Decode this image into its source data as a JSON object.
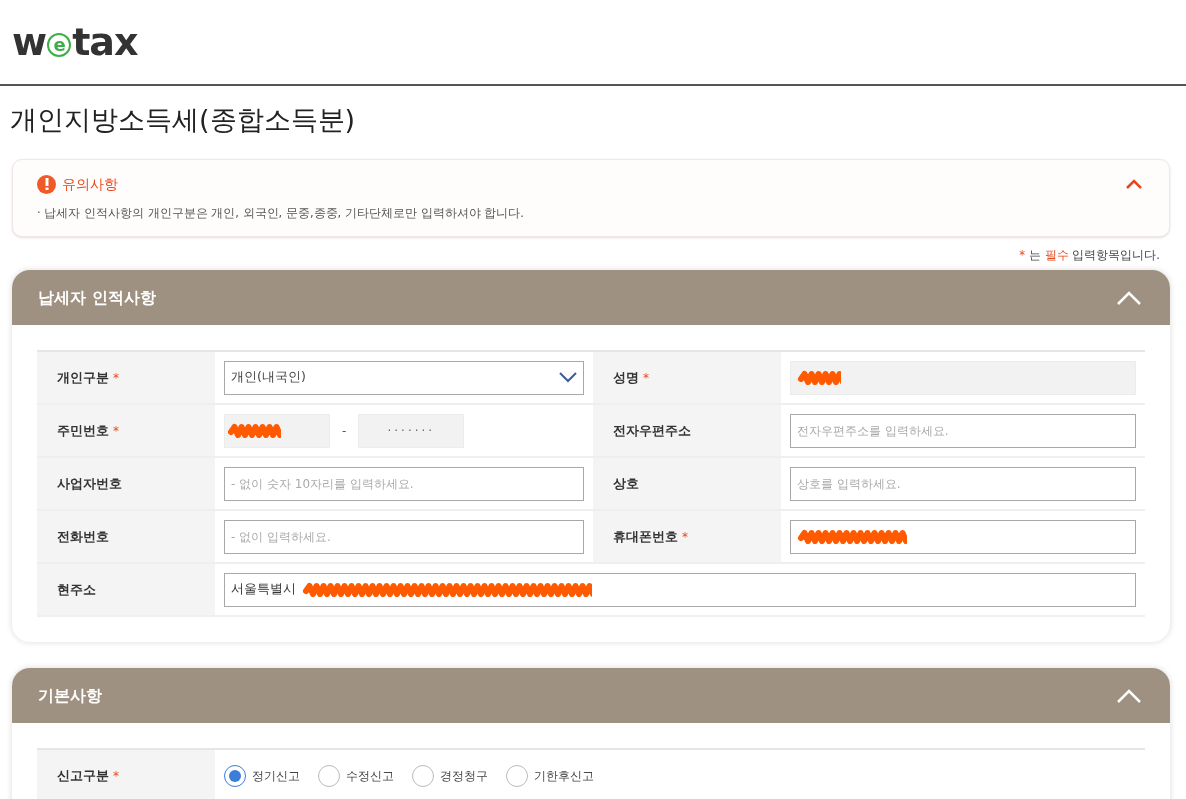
{
  "logo": {
    "before": "w",
    "mark": "e",
    "after": "tax"
  },
  "page_title": "개인지방소득세(종합소득분)",
  "notice": {
    "title": "유의사항",
    "expanded": true,
    "items": [
      "· 납세자 인적사항의 개인구분은 개인, 외국인, 문중,종중, 기타단체로만 입력하셔야 합니다."
    ]
  },
  "required_note": {
    "mark": "*",
    "text": "는 **필수** 입력항목입니다."
  },
  "sections": [
    {
      "title": "납세자 인적사항",
      "expanded": true,
      "rows": [
        [
          {
            "label": "개인구분",
            "required": true,
            "field": {
              "kind": "select",
              "value": "개인(내국인)"
            }
          },
          {
            "label": "성명",
            "required": true,
            "field": {
              "kind": "readonly",
              "redacted": true
            }
          }
        ],
        [
          {
            "label": "주민번호",
            "required": true,
            "field": {
              "kind": "split",
              "first": {
                "redacted": true
              },
              "separator": "-",
              "second": {
                "value": "·······"
              }
            }
          },
          {
            "label": "전자우편주소",
            "required": false,
            "field": {
              "kind": "text",
              "placeholder": "전자우편주소를 입력하세요."
            }
          }
        ],
        [
          {
            "label": "사업자번호",
            "required": false,
            "field": {
              "kind": "text",
              "placeholder": "- 없이 숫자 10자리를 입력하세요."
            }
          },
          {
            "label": "상호",
            "required": false,
            "field": {
              "kind": "text",
              "placeholder": "상호를 입력하세요."
            }
          }
        ],
        [
          {
            "label": "전화번호",
            "required": false,
            "field": {
              "kind": "text",
              "placeholder": "- 없이 입력하세요."
            }
          },
          {
            "label": "휴대폰번호",
            "required": true,
            "field": {
              "kind": "text",
              "redacted": true
            }
          }
        ],
        [
          {
            "label": "현주소",
            "required": false,
            "field": {
              "kind": "text",
              "value": "서울특별시",
              "redacted": true
            }
          }
        ]
      ]
    },
    {
      "title": "기본사항",
      "expanded": true,
      "rows": [
        [
          {
            "label": "신고구분",
            "required": true,
            "field": {
              "kind": "radio",
              "options": [
                {
                  "label": "정기신고",
                  "selected": true
                },
                {
                  "label": "수정신고",
                  "selected": false
                },
                {
                  "label": "경정청구",
                  "selected": false
                },
                {
                  "label": "기한후신고",
                  "selected": false
                }
              ]
            }
          }
        ]
      ]
    }
  ]
}
